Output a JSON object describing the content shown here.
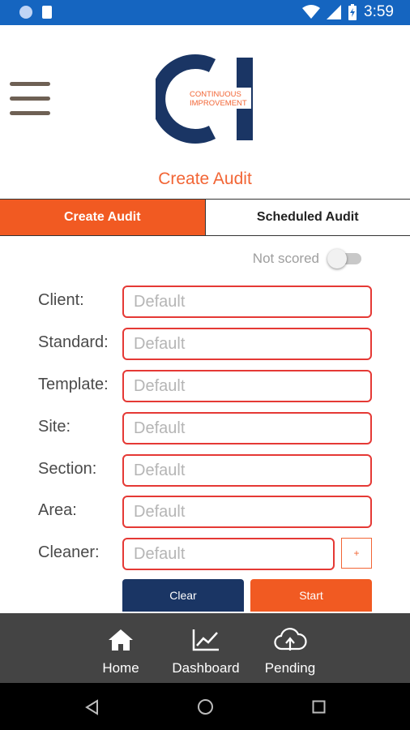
{
  "status_bar": {
    "time": "3:59"
  },
  "app": {
    "logo_letters": "CI",
    "logo_line1": "CONTINUOUS",
    "logo_line2": "IMPROVEMENT",
    "page_title": "Create Audit"
  },
  "tabs": [
    {
      "label": "Create Audit",
      "active": true
    },
    {
      "label": "Scheduled Audit",
      "active": false
    }
  ],
  "scored_toggle": {
    "label": "Not scored",
    "on": false
  },
  "form": {
    "fields": [
      {
        "label": "Client:",
        "placeholder": "Default"
      },
      {
        "label": "Standard:",
        "placeholder": "Default"
      },
      {
        "label": "Template:",
        "placeholder": "Default"
      },
      {
        "label": "Site:",
        "placeholder": "Default"
      },
      {
        "label": "Section:",
        "placeholder": "Default"
      },
      {
        "label": "Area:",
        "placeholder": "Default"
      },
      {
        "label": "Cleaner:",
        "placeholder": "Default"
      }
    ],
    "add_label": "+",
    "clear_label": "Clear",
    "start_label": "Start"
  },
  "bottom_nav": [
    {
      "label": "Home",
      "icon": "home-icon"
    },
    {
      "label": "Dashboard",
      "icon": "chart-icon"
    },
    {
      "label": "Pending",
      "icon": "cloud-upload-icon"
    }
  ],
  "colors": {
    "accent_orange": "#f15a22",
    "navy": "#1a3564",
    "status_blue": "#1565c0",
    "field_border": "#e53935"
  }
}
